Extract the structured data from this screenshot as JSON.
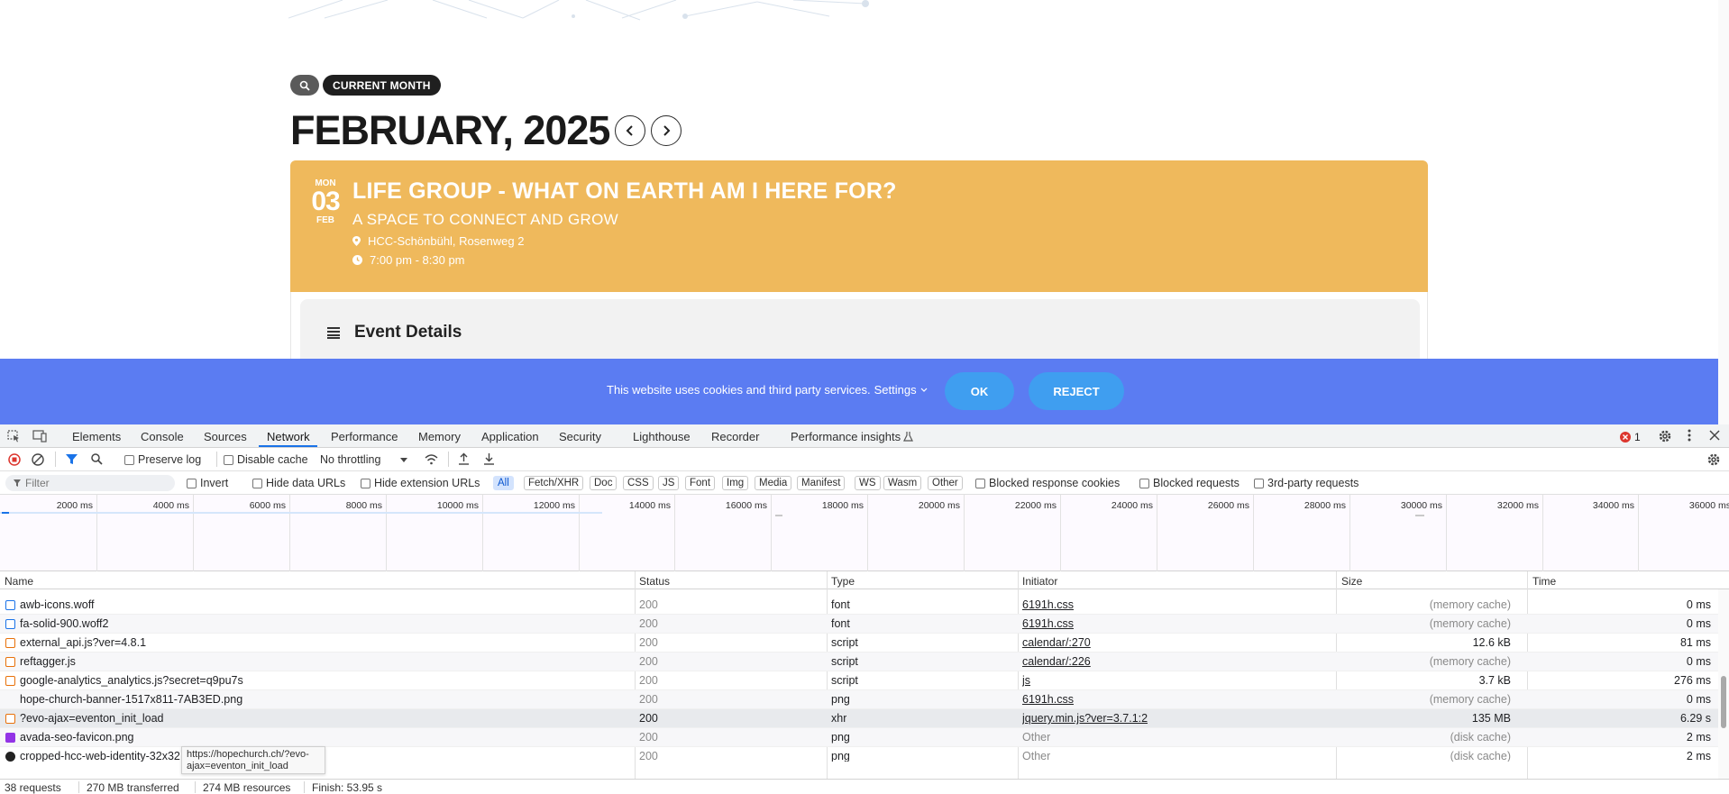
{
  "webpage": {
    "current_month_label": "CURRENT MONTH",
    "month_title": "FEBRUARY, 2025",
    "event": {
      "dow": "MON",
      "day": "03",
      "month": "FEB",
      "title": "LIFE GROUP - WHAT ON EARTH AM I HERE FOR?",
      "subtitle": "A SPACE TO CONNECT AND GROW",
      "location": "HCC-Schönbühl, Rosenweg 2",
      "time": "7:00 pm - 8:30 pm",
      "color": "#efb95c"
    },
    "details_title": "Event Details",
    "cookie": {
      "text": "This website uses cookies and third party services.",
      "settings": "Settings",
      "ok": "OK",
      "reject": "REJECT",
      "color": "#5b7cf2"
    }
  },
  "devtools": {
    "tabs": [
      "Elements",
      "Console",
      "Sources",
      "Network",
      "Performance",
      "Memory",
      "Application",
      "Security",
      "Lighthouse",
      "Recorder",
      "Performance insights"
    ],
    "active_tab": "Network",
    "error_count": "1",
    "toolbar": {
      "preserve_log": "Preserve log",
      "disable_cache": "Disable cache",
      "throttling": "No throttling"
    },
    "filter": {
      "placeholder": "Filter",
      "invert": "Invert",
      "hide_data_urls": "Hide data URLs",
      "hide_extension_urls": "Hide extension URLs",
      "types": [
        "All",
        "Fetch/XHR",
        "Doc",
        "CSS",
        "JS",
        "Font",
        "Img",
        "Media",
        "Manifest",
        "WS",
        "Wasm",
        "Other"
      ],
      "blocked_response_cookies": "Blocked response cookies",
      "blocked_requests": "Blocked requests",
      "third_party": "3rd-party requests"
    },
    "timeline_ticks": [
      "2000 ms",
      "4000 ms",
      "6000 ms",
      "8000 ms",
      "10000 ms",
      "12000 ms",
      "14000 ms",
      "16000 ms",
      "18000 ms",
      "20000 ms",
      "22000 ms",
      "24000 ms",
      "26000 ms",
      "28000 ms",
      "30000 ms",
      "32000 ms",
      "34000 ms",
      "36000 ms"
    ],
    "columns": {
      "name": "Name",
      "status": "Status",
      "type": "Type",
      "initiator": "Initiator",
      "size": "Size",
      "time": "Time"
    },
    "rows": [
      {
        "name": "awb-icons.woff",
        "status": "200",
        "type": "font",
        "initiator": "6191h.css",
        "size": "(memory cache)",
        "time": "0 ms",
        "icon": "font-file-icon"
      },
      {
        "name": "fa-solid-900.woff2",
        "status": "200",
        "type": "font",
        "initiator": "6191h.css",
        "size": "(memory cache)",
        "time": "0 ms",
        "icon": "font-file-icon"
      },
      {
        "name": "external_api.js?ver=4.8.1",
        "status": "200",
        "type": "script",
        "initiator": "calendar/:270",
        "size": "12.6 kB",
        "time": "81 ms",
        "icon": "script-file-icon"
      },
      {
        "name": "reftagger.js",
        "status": "200",
        "type": "script",
        "initiator": "calendar/:226",
        "size": "(memory cache)",
        "time": "0 ms",
        "icon": "script-file-icon"
      },
      {
        "name": "google-analytics_analytics.js?secret=q9pu7s",
        "status": "200",
        "type": "script",
        "initiator": "js",
        "size": "3.7 kB",
        "time": "276 ms",
        "icon": "script-file-icon"
      },
      {
        "name": "hope-church-banner-1517x811-7AB3ED.png",
        "status": "200",
        "type": "png",
        "initiator": "6191h.css",
        "size": "(memory cache)",
        "time": "0 ms",
        "icon": "image-file-icon"
      },
      {
        "name": "?evo-ajax=eventon_init_load",
        "status": "200",
        "type": "xhr",
        "initiator": "jquery.min.js?ver=3.7.1:2",
        "size": "135 MB",
        "time": "6.29 s",
        "icon": "xhr-icon"
      },
      {
        "name": "avada-seo-favicon.png",
        "status": "200",
        "type": "png",
        "initiator": "Other",
        "size": "(disk cache)",
        "time": "2 ms",
        "icon": "favicon-icon"
      },
      {
        "name": "cropped-hcc-web-identity-32x32.png",
        "status": "200",
        "type": "png",
        "initiator": "Other",
        "size": "(disk cache)",
        "time": "2 ms",
        "icon": "favicon-icon"
      }
    ],
    "tooltip": "https://hopechurch.ch/?evo-ajax=eventon_init_load",
    "status_bar": {
      "requests": "38 requests",
      "transferred": "270 MB transferred",
      "resources": "274 MB resources",
      "finish": "Finish: 53.95 s"
    }
  }
}
